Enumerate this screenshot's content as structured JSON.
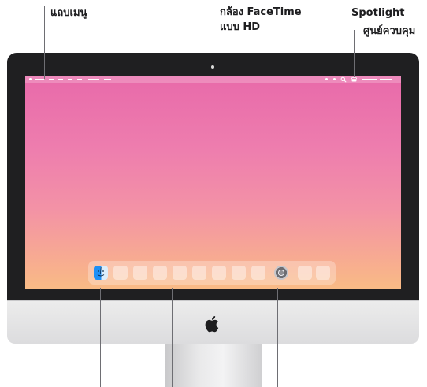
{
  "labels": {
    "menu_bar": "แถบเมนู",
    "camera_line1": "กล้อง FaceTime",
    "camera_line2": "แบบ HD",
    "spotlight": "Spotlight",
    "control_center": "ศูนย์ควบคุม"
  },
  "icons": {
    "finder": "finder-icon",
    "system_settings": "settings-gear-icon",
    "apple_logo": "apple-logo-icon",
    "spotlight": "search-icon",
    "control_center": "control-center-icon"
  },
  "colors": {
    "bezel": "#1f1f21",
    "chin": "#e4e4e6",
    "wallpaper_top": "#e86aaa",
    "wallpaper_bottom": "#f9bb85",
    "callout_line": "#6e6e73"
  }
}
